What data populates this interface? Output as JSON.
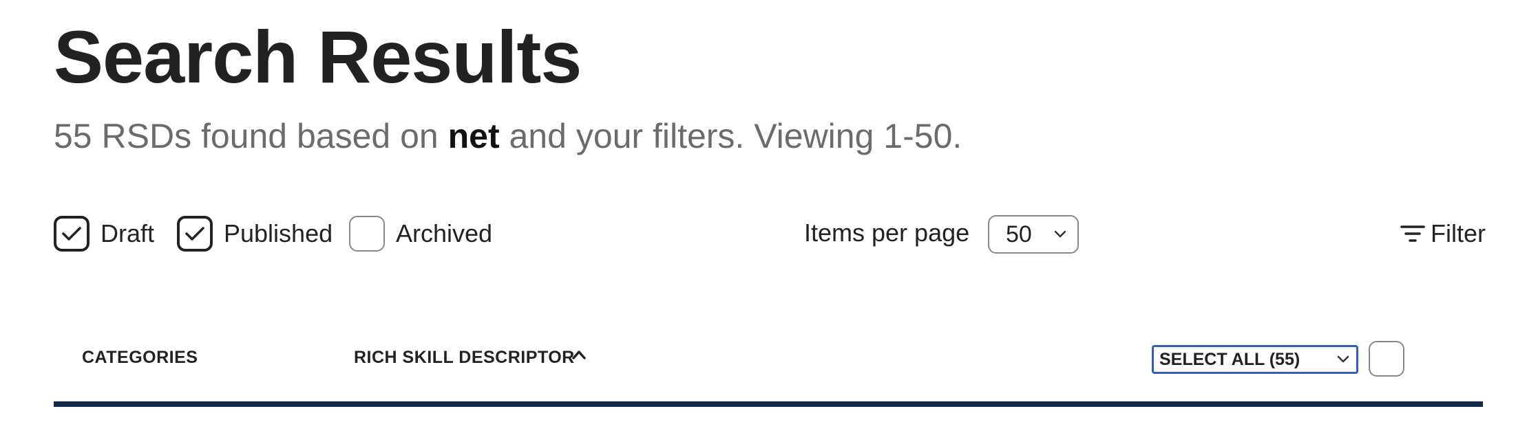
{
  "page": {
    "title": "Search Results",
    "summary": {
      "prefix": "55 RSDs found based on ",
      "query": "net",
      "suffix": " and your filters. Viewing 1-50."
    }
  },
  "status_filters": [
    {
      "label": "Draft",
      "checked": true
    },
    {
      "label": "Published",
      "checked": true
    },
    {
      "label": "Archived",
      "checked": false
    }
  ],
  "pagination": {
    "items_per_page_label": "Items per page",
    "items_per_page_value": "50"
  },
  "filter_button": {
    "label": "Filter",
    "icon": "filter-lines-icon"
  },
  "table_header": {
    "categories": "CATEGORIES",
    "rich_skill_descriptor": "RICH SKILL DESCRIPTOR",
    "sort_icon": "chevron-up-icon",
    "select_all": "SELECT ALL (55)"
  },
  "colors": {
    "divider": "#142a4a",
    "select_focus_border": "#2f5fb8",
    "subtitle_text": "#6b6b6b"
  }
}
